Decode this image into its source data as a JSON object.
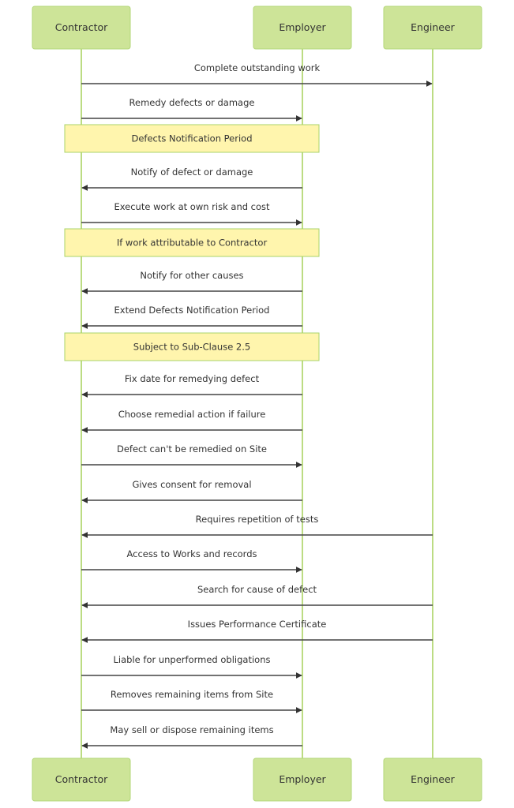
{
  "diagram": {
    "type": "sequence",
    "colors": {
      "actor_fill": "#cde498",
      "actor_border": "#b3d77a",
      "lifeline": "#a5d15a",
      "message": "#444444",
      "note_fill": "#fff5ad",
      "note_border": "#aad36a",
      "text": "#333333"
    },
    "actors": [
      {
        "id": "contractor",
        "label": "Contractor"
      },
      {
        "id": "employer",
        "label": "Employer"
      },
      {
        "id": "engineer",
        "label": "Engineer"
      }
    ],
    "steps": [
      {
        "kind": "message",
        "from": "contractor",
        "to": "engineer",
        "label": "Complete outstanding work"
      },
      {
        "kind": "message",
        "from": "contractor",
        "to": "employer",
        "label": "Remedy defects or damage"
      },
      {
        "kind": "note",
        "over": [
          "contractor",
          "employer"
        ],
        "label": "Defects Notification Period"
      },
      {
        "kind": "message",
        "from": "employer",
        "to": "contractor",
        "label": "Notify of defect or damage"
      },
      {
        "kind": "message",
        "from": "contractor",
        "to": "employer",
        "label": "Execute work at own risk and cost"
      },
      {
        "kind": "note",
        "over": [
          "contractor",
          "employer"
        ],
        "label": "If work attributable to Contractor"
      },
      {
        "kind": "message",
        "from": "employer",
        "to": "contractor",
        "label": "Notify for other causes"
      },
      {
        "kind": "message",
        "from": "employer",
        "to": "contractor",
        "label": "Extend Defects Notification Period"
      },
      {
        "kind": "note",
        "over": [
          "contractor",
          "employer"
        ],
        "label": "Subject to Sub-Clause 2.5"
      },
      {
        "kind": "message",
        "from": "employer",
        "to": "contractor",
        "label": "Fix date for remedying defect"
      },
      {
        "kind": "message",
        "from": "employer",
        "to": "contractor",
        "label": "Choose remedial action if failure"
      },
      {
        "kind": "message",
        "from": "contractor",
        "to": "employer",
        "label": "Defect can't be remedied on Site"
      },
      {
        "kind": "message",
        "from": "employer",
        "to": "contractor",
        "label": "Gives consent for removal"
      },
      {
        "kind": "message",
        "from": "engineer",
        "to": "contractor",
        "label": "Requires repetition of tests"
      },
      {
        "kind": "message",
        "from": "contractor",
        "to": "employer",
        "label": "Access to Works and records"
      },
      {
        "kind": "message",
        "from": "engineer",
        "to": "contractor",
        "label": "Search for cause of defect"
      },
      {
        "kind": "message",
        "from": "engineer",
        "to": "contractor",
        "label": "Issues Performance Certificate"
      },
      {
        "kind": "message",
        "from": "contractor",
        "to": "employer",
        "label": "Liable for unperformed obligations"
      },
      {
        "kind": "message",
        "from": "contractor",
        "to": "employer",
        "label": "Removes remaining items from Site"
      },
      {
        "kind": "message",
        "from": "employer",
        "to": "contractor",
        "label": "May sell or dispose remaining items"
      }
    ]
  }
}
